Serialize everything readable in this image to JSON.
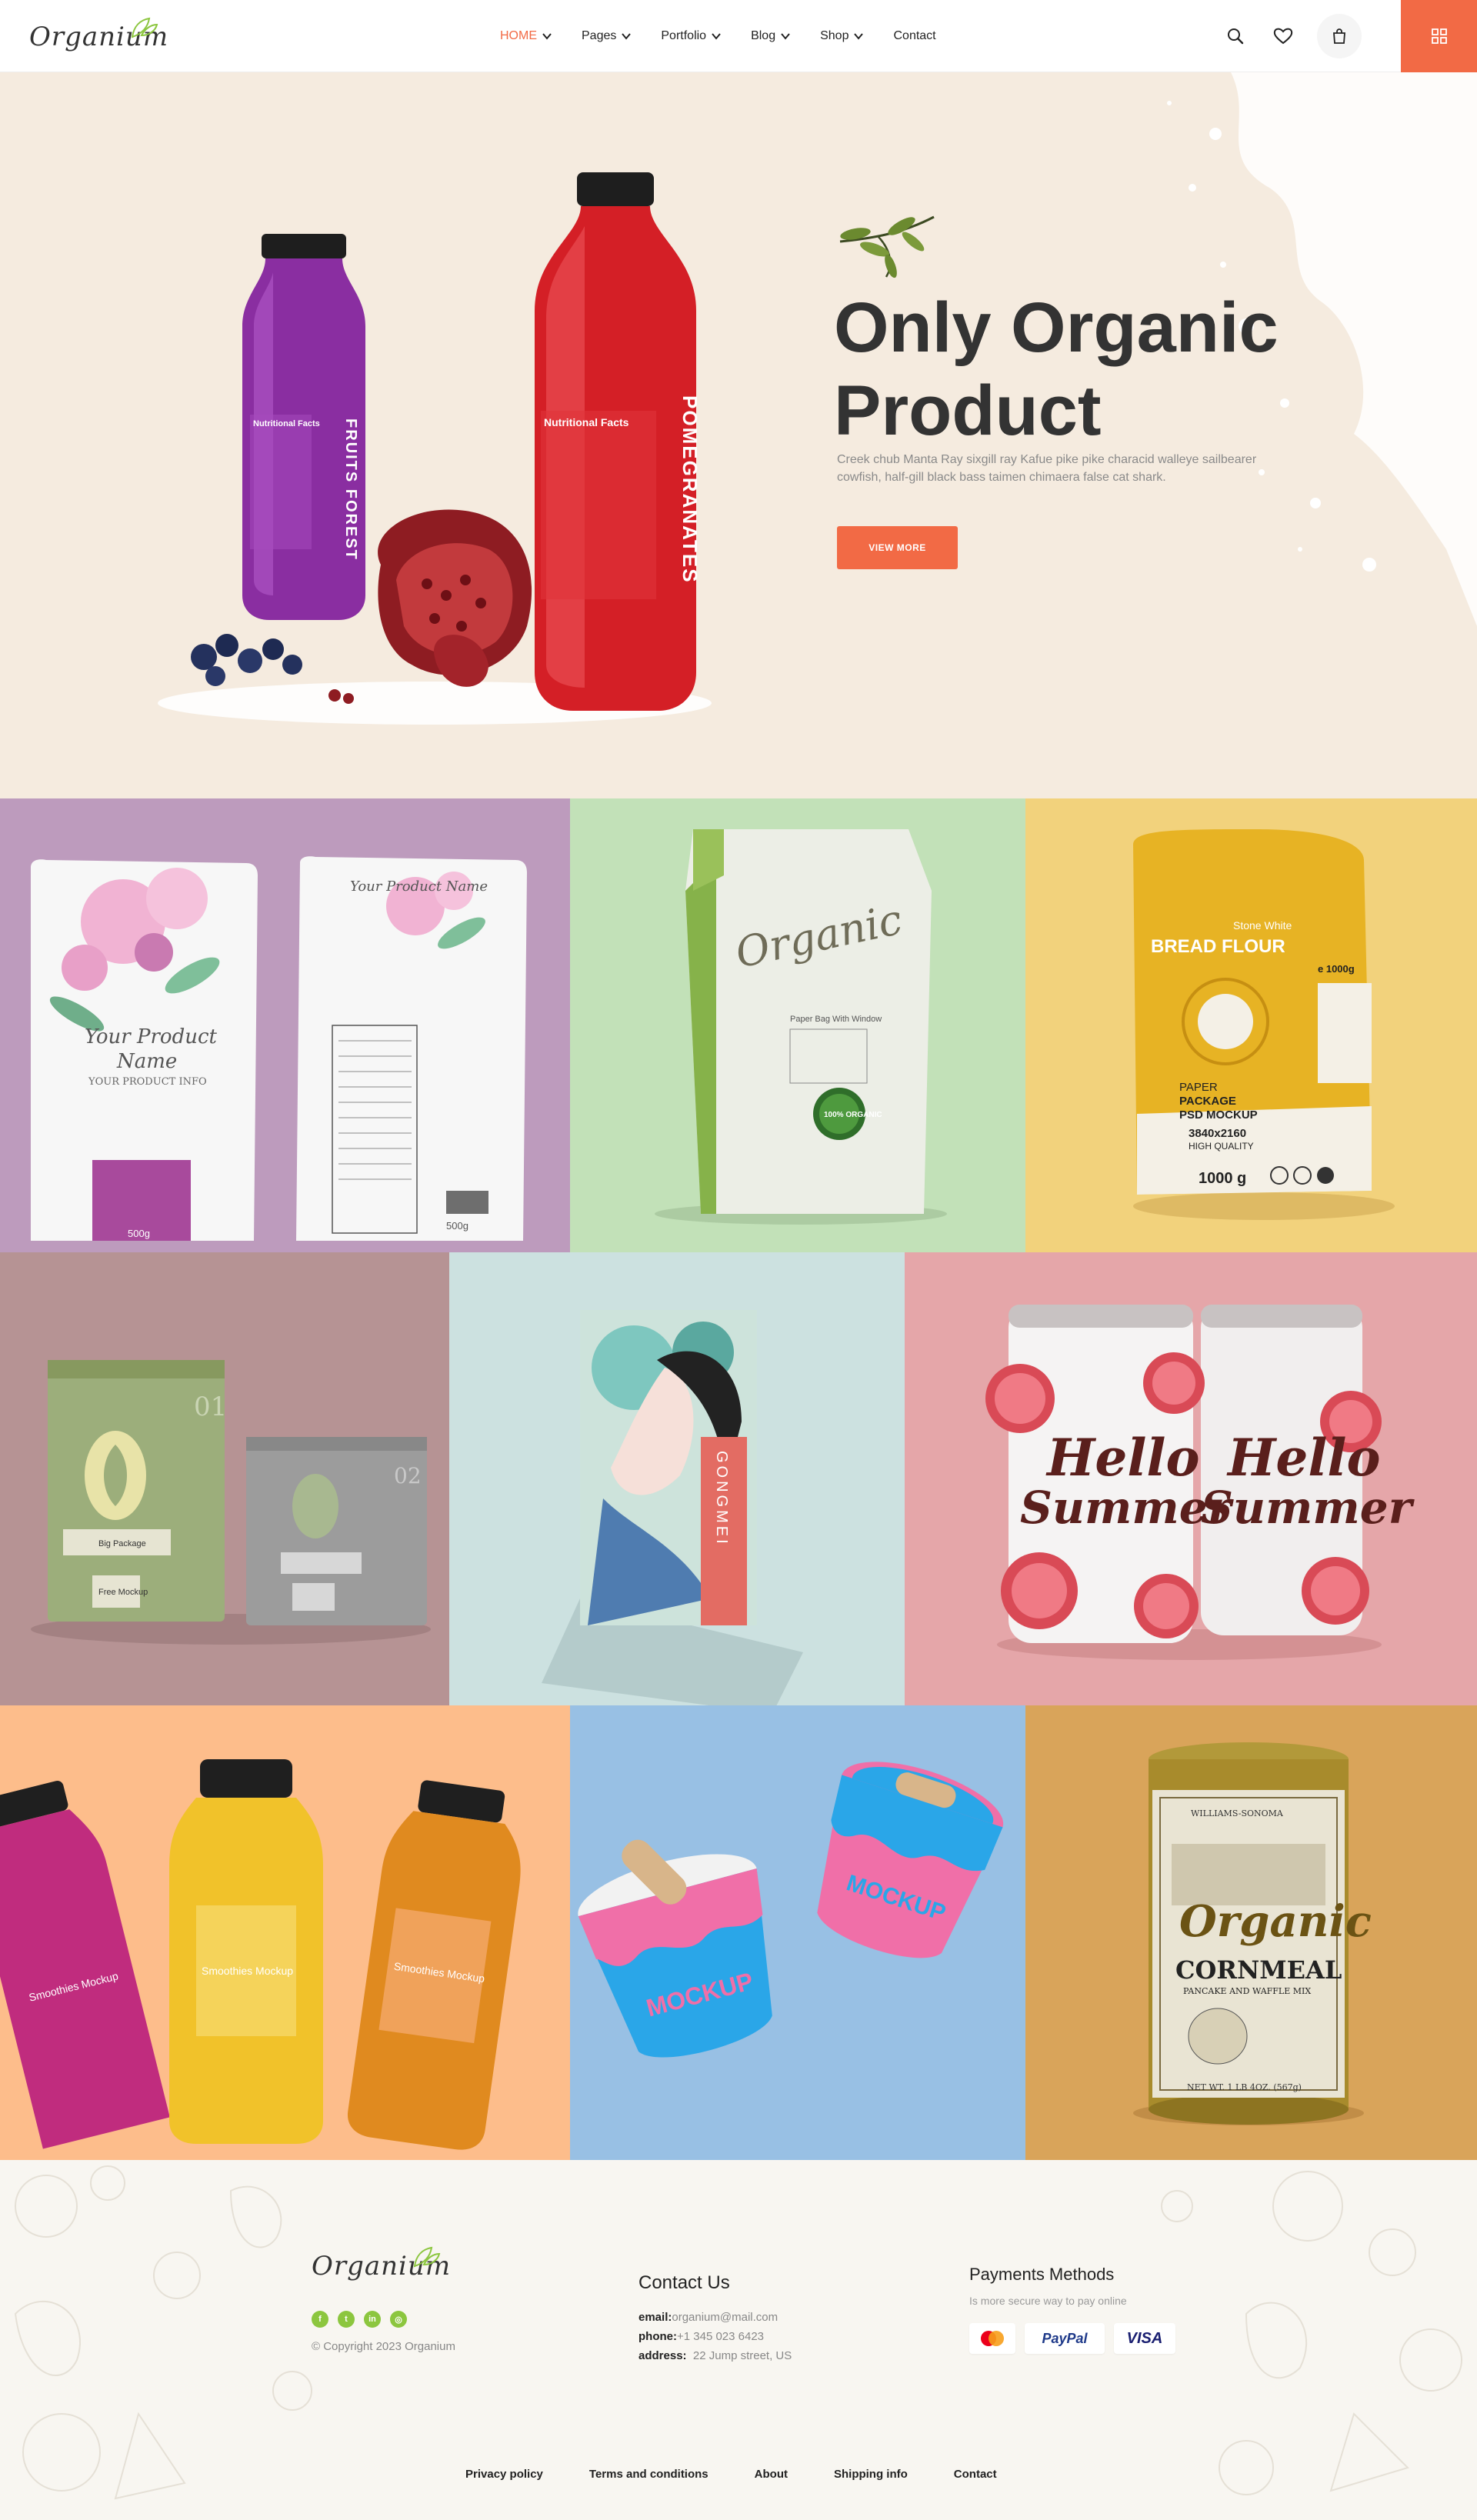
{
  "brand": {
    "name": "Organium",
    "accent": "#f26a45",
    "green": "#8cc63f"
  },
  "nav": {
    "items": [
      {
        "label": "HOME",
        "active": true,
        "dropdown": true
      },
      {
        "label": "Pages",
        "dropdown": true
      },
      {
        "label": "Portfolio",
        "dropdown": true
      },
      {
        "label": "Blog",
        "dropdown": true
      },
      {
        "label": "Shop",
        "dropdown": true
      },
      {
        "label": "Contact",
        "dropdown": false
      }
    ],
    "icons": [
      "search-icon",
      "heart-icon",
      "cart-icon",
      "grid-menu-icon"
    ]
  },
  "hero": {
    "title_line1": "Only Organic",
    "title_line2": "Product",
    "description": "Creek chub Manta Ray sixgill ray Kafue pike pike characid walleye sailbearer cowfish, half-gill black bass taimen chimaera false cat shark.",
    "button": "VIEW MORE",
    "bottle_purple_label": "FRUITS FOREST",
    "bottle_red_label": "POMEGRANATES",
    "nutrition_label": "Nutritional Facts",
    "bg": "#f5ebdf"
  },
  "gallery": {
    "pouch": {
      "name_line1": "Your Product",
      "name_line2": "Name",
      "info": "YOUR PRODUCT INFO",
      "weight": "500g",
      "back_title": "Your Product Name"
    },
    "paper_bag": {
      "brand": "Organic",
      "sub": "Paper Bag With Window",
      "badge": "100% ORGANIC"
    },
    "flour": {
      "title": "BREAD FLOUR",
      "sub": "Stone White",
      "weight": "e 1000g",
      "paper": "PAPER",
      "package": "PACKAGE",
      "mockup": "PSD MOCKUP",
      "resolution": "3840x2160",
      "quality": "HIGH QUALITY",
      "net": "1000 g"
    },
    "tins": {
      "num1": "01",
      "num2": "02",
      "label": "Big Package",
      "free": "Free Mockup"
    },
    "box": {
      "brand": "GONGMEI"
    },
    "cans": {
      "line1": "Hello",
      "line2": "Summer"
    },
    "smoothie": {
      "name": "Smoothies Mockup"
    },
    "icecream": {
      "label": "MOCKUP"
    },
    "cornmeal": {
      "top": "WILLIAMS-SONOMA",
      "brand": "Organic",
      "title": "CORNMEAL",
      "sub": "PANCAKE AND WAFFLE MIX",
      "net": "NET WT. 1 LB 4OZ. (567g)"
    }
  },
  "footer": {
    "copyright": "© Copyright 2023 Organium",
    "contact_title": "Contact Us",
    "email_label": "email:",
    "email": "organium@mail.com",
    "phone_label": "phone:",
    "phone": "+1 345 023 6423",
    "address_label": "address:",
    "address": "22 Jump street, US",
    "payments_title": "Payments Methods",
    "payments_sub": "Is more secure way to pay online",
    "cards": [
      "Mastercard",
      "PayPal",
      "VISA"
    ],
    "paypal": "PayPal",
    "visa": "VISA",
    "links": [
      "Privacy policy",
      "Terms and conditions",
      "About",
      "Shipping info",
      "Contact"
    ]
  }
}
